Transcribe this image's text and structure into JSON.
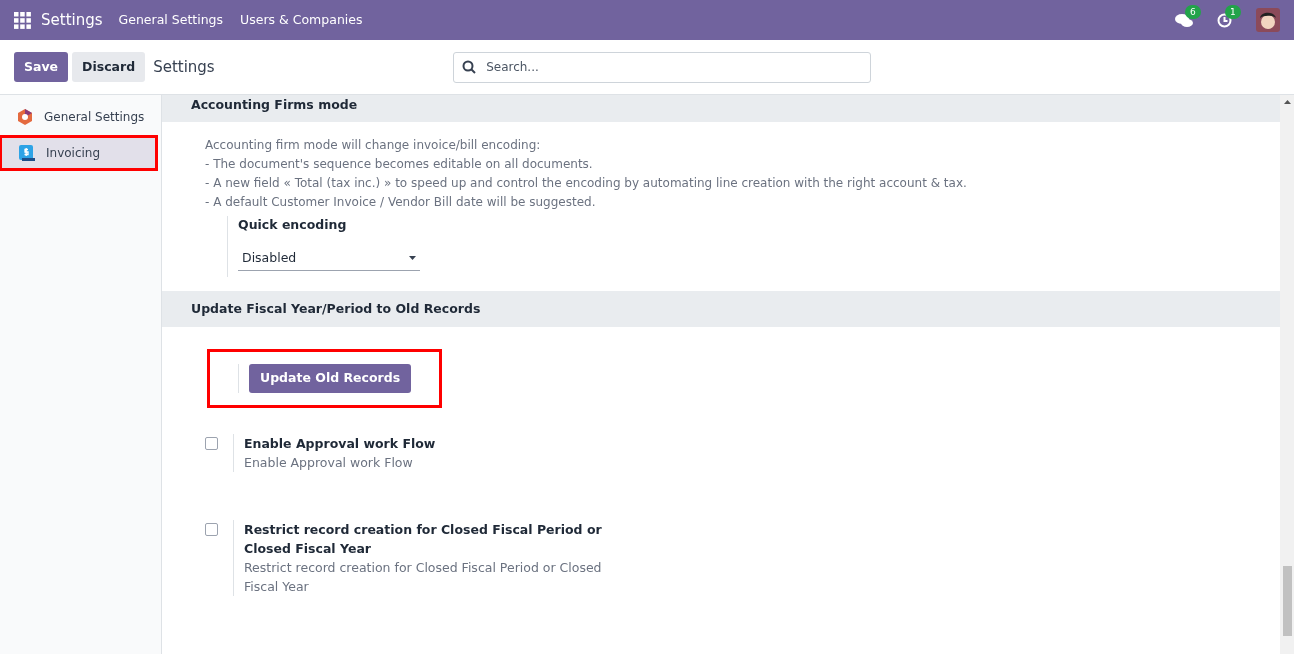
{
  "navbar": {
    "app_title": "Settings",
    "menu": [
      "General Settings",
      "Users & Companies"
    ],
    "messages_count": "6",
    "activities_count": "1"
  },
  "control_panel": {
    "buttons": [
      {
        "label": "Save",
        "kind": "primary"
      },
      {
        "label": "Discard",
        "kind": "secondary"
      }
    ],
    "breadcrumb": "Settings",
    "search": {
      "placeholder": "Search..."
    }
  },
  "sidebar": {
    "items": [
      {
        "label": "General Settings",
        "kind": "general",
        "selected": false,
        "highlighted": false
      },
      {
        "label": "Invoicing",
        "kind": "invoicing",
        "selected": true,
        "highlighted": true
      }
    ]
  },
  "sections": [
    {
      "title": "Accounting Firms mode",
      "description": [
        "Accounting firm mode will change invoice/bill encoding:",
        "- The document's sequence becomes editable on all documents.",
        "- A new field « Total (tax inc.) » to speed up and control the encoding by automating line creation with the right account & tax.",
        "- A default Customer Invoice / Vendor Bill date will be suggested."
      ],
      "settings": [
        {
          "kind": "select",
          "label": "Quick encoding",
          "value": "Disabled"
        }
      ]
    },
    {
      "title": "Update Fiscal Year/Period to Old Records",
      "settings": [
        {
          "kind": "button",
          "label": "Update Old Records",
          "highlighted": true
        },
        {
          "kind": "checkbox",
          "label": "Enable Approval work Flow",
          "help": "Enable Approval work Flow",
          "checked": false
        },
        {
          "kind": "checkbox",
          "label": "Restrict record creation for Closed Fiscal Period or Closed Fiscal Year",
          "help": "Restrict record creation for Closed Fiscal Period or Closed Fiscal Year",
          "checked": false
        }
      ]
    }
  ]
}
